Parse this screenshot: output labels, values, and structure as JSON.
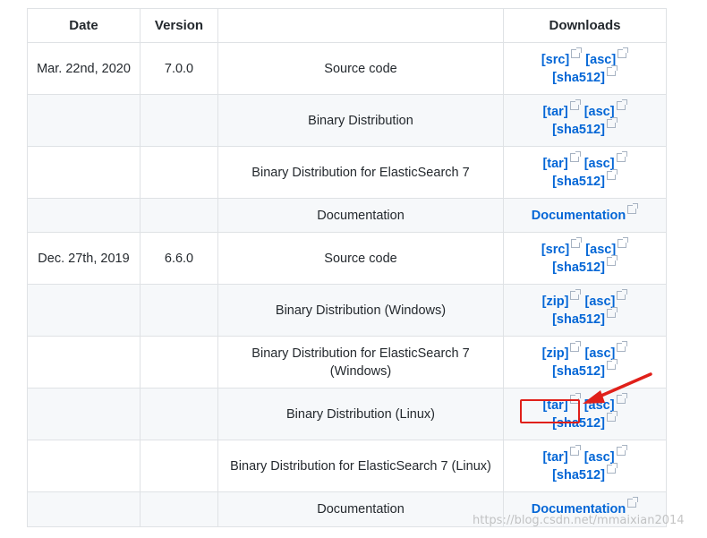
{
  "table": {
    "headers": {
      "date": "Date",
      "version": "Version",
      "description": "",
      "downloads": "Downloads"
    },
    "rows": [
      {
        "date": "Mar. 22nd, 2020",
        "version": "7.0.0",
        "description": "Source code",
        "links": [
          "[src]",
          "[asc]",
          "[sha512]"
        ],
        "alt": false
      },
      {
        "date": "",
        "version": "",
        "description": "Binary Distribution",
        "links": [
          "[tar]",
          "[asc]",
          "[sha512]"
        ],
        "alt": true
      },
      {
        "date": "",
        "version": "",
        "description": "Binary Distribution for ElasticSearch 7",
        "links": [
          "[tar]",
          "[asc]",
          "[sha512]"
        ],
        "alt": false
      },
      {
        "date": "",
        "version": "",
        "description": "Documentation",
        "links": [
          "Documentation"
        ],
        "alt": true,
        "doc": true
      },
      {
        "date": "Dec. 27th, 2019",
        "version": "6.6.0",
        "description": "Source code",
        "links": [
          "[src]",
          "[asc]",
          "[sha512]"
        ],
        "alt": false
      },
      {
        "date": "",
        "version": "",
        "description": "Binary Distribution (Windows)",
        "links": [
          "[zip]",
          "[asc]",
          "[sha512]"
        ],
        "alt": true
      },
      {
        "date": "",
        "version": "",
        "description": "Binary Distribution for ElasticSearch 7 (Windows)",
        "links": [
          "[zip]",
          "[asc]",
          "[sha512]"
        ],
        "alt": false
      },
      {
        "date": "",
        "version": "",
        "description": "Binary Distribution (Linux)",
        "links": [
          "[tar]",
          "[asc]",
          "[sha512]"
        ],
        "alt": true,
        "highlight": true
      },
      {
        "date": "",
        "version": "",
        "description": "Binary Distribution for ElasticSearch 7 (Linux)",
        "links": [
          "[tar]",
          "[asc]",
          "[sha512]"
        ],
        "alt": false
      },
      {
        "date": "",
        "version": "",
        "description": "Documentation",
        "links": [
          "Documentation"
        ],
        "alt": true,
        "doc": true
      }
    ]
  },
  "watermark": "https://blog.csdn.net/mmaixian2014",
  "colors": {
    "link": "#0366d6",
    "border": "#dfe2e5",
    "stripe": "#f6f8fa",
    "annotation": "#e0201a"
  },
  "icons": {
    "external_link": "external-link-icon",
    "annotation_arrow": "arrow-icon"
  }
}
